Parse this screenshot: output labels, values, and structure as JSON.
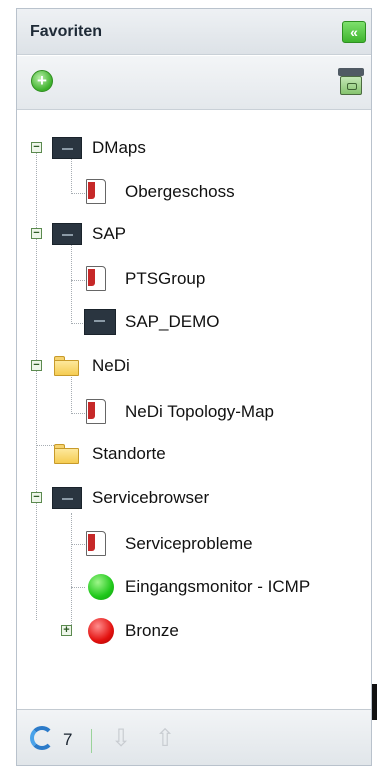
{
  "panel": {
    "title": "Favoriten",
    "collapse_icon": "double-chevron-left-icon",
    "toolbar": {
      "add_icon": "add-icon",
      "archive_icon": "archive-icon"
    }
  },
  "tree": {
    "dmaps": {
      "label": "DMaps",
      "toggle": "−"
    },
    "obergeschoss": {
      "label": "Obergeschoss"
    },
    "sap": {
      "label": "SAP",
      "toggle": "−"
    },
    "ptsgroup": {
      "label": "PTSGroup"
    },
    "sap_demo": {
      "label": "SAP_DEMO"
    },
    "nedi": {
      "label": "NeDi",
      "toggle": "−"
    },
    "nedi_topology": {
      "label": "NeDi Topology-Map"
    },
    "standorte": {
      "label": "Standorte"
    },
    "servicebrowser": {
      "label": "Servicebrowser",
      "toggle": "−"
    },
    "serviceprobleme": {
      "label": "Serviceprobleme"
    },
    "eingangsmonitor": {
      "label": "Eingangsmonitor - ICMP",
      "status_color": "#1fc81a"
    },
    "bronze": {
      "label": "Bronze",
      "toggle": "+",
      "status_color": "#e3110f"
    }
  },
  "footer": {
    "refresh_icon": "refresh-icon",
    "count": "7",
    "down_label": "⇩",
    "up_label": "⇧"
  }
}
